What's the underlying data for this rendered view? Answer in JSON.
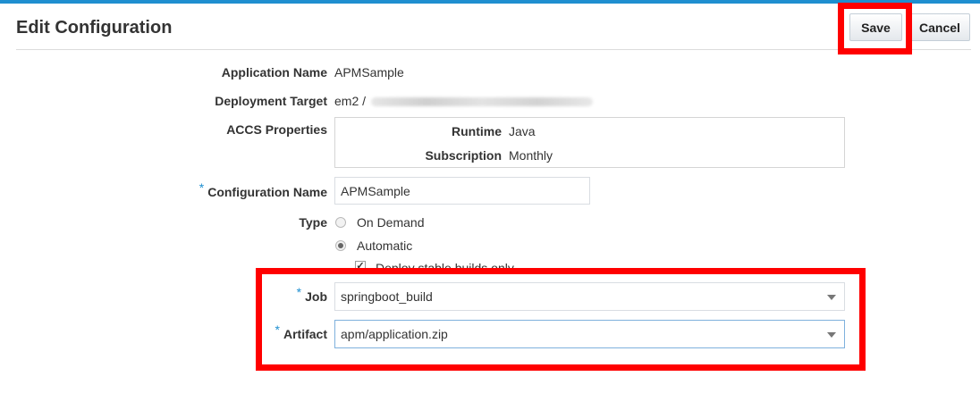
{
  "header": {
    "title": "Edit Configuration",
    "save_label": "Save",
    "cancel_label": "Cancel"
  },
  "details": {
    "app_name_label": "Application Name",
    "app_name_value": "APMSample",
    "deploy_target_label": "Deployment Target",
    "deploy_target_value": "em2 /",
    "accs_label": "ACCS Properties",
    "runtime_label": "Runtime",
    "runtime_value": "Java",
    "subscription_label": "Subscription",
    "subscription_value": "Monthly"
  },
  "form": {
    "config_name_label": "Configuration Name",
    "config_name_value": "APMSample",
    "type_label": "Type",
    "type_options": [
      {
        "label": "On Demand",
        "selected": false
      },
      {
        "label": "Automatic",
        "selected": true
      }
    ],
    "deploy_stable_label": "Deploy stable builds only",
    "deploy_stable_checked": true,
    "job_label": "Job",
    "job_value": "springboot_build",
    "artifact_label": "Artifact",
    "artifact_value": "apm/application.zip",
    "required_marker": "*"
  },
  "colors": {
    "accent": "#1f8fd0",
    "highlight": "#ff0000"
  }
}
